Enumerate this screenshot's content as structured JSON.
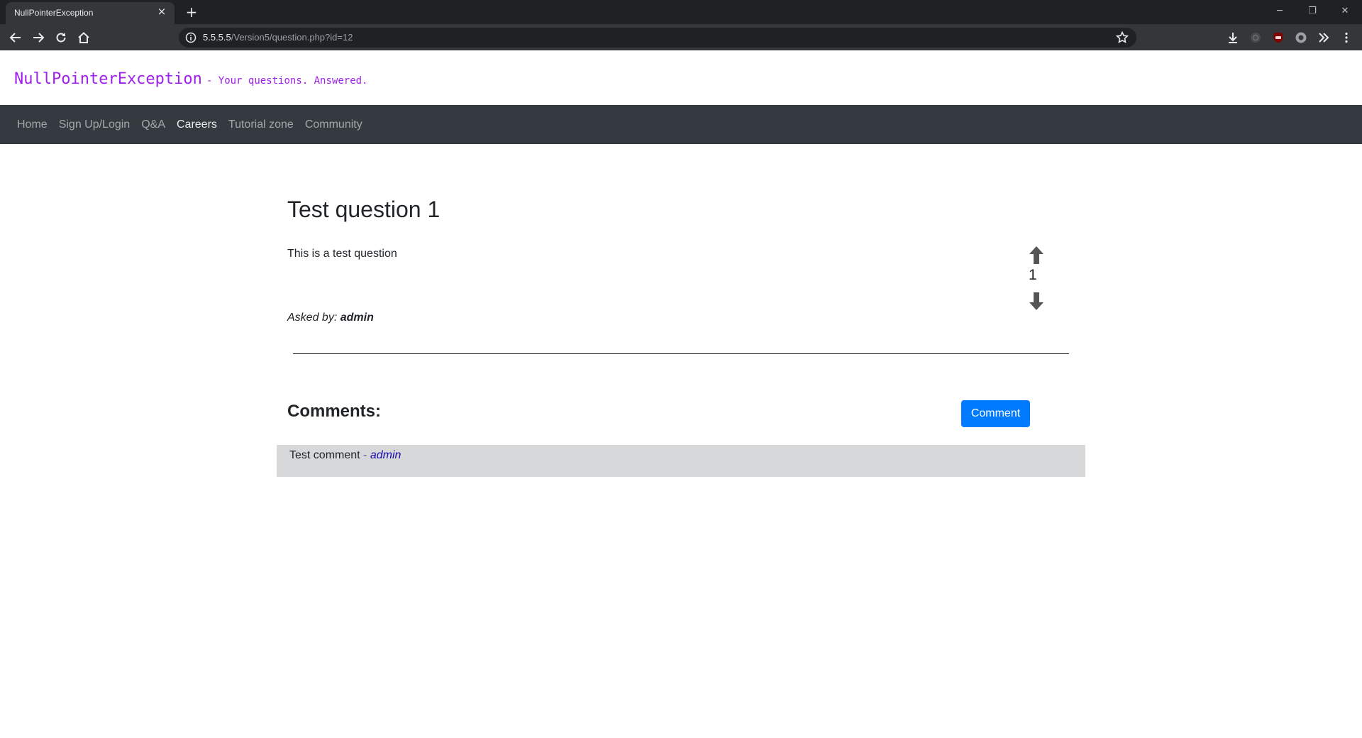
{
  "browser": {
    "tab_title": "NullPointerException",
    "tab_close": "×",
    "new_tab": "+",
    "url_host": "5.5.5.5",
    "url_path": "/Version5/question.php?id=12",
    "window_controls": {
      "minimize": "─",
      "restore": "❐",
      "close": "✕"
    }
  },
  "site": {
    "brand_name": "NullPointerException",
    "tagline": "- Your questions. Answered.",
    "brand_color": "#a020f0",
    "nav": [
      {
        "label": "Home",
        "active": false
      },
      {
        "label": "Sign Up/Login",
        "active": false
      },
      {
        "label": "Q&A",
        "active": false
      },
      {
        "label": "Careers",
        "active": true
      },
      {
        "label": "Tutorial zone",
        "active": false
      },
      {
        "label": "Community",
        "active": false
      }
    ]
  },
  "question": {
    "title": "Test question 1",
    "body": "This is a test question",
    "asked_by_label": "Asked by:",
    "author": "admin",
    "votes": "1"
  },
  "comments": {
    "heading": "Comments:",
    "button_label": "Comment",
    "button_color": "#007bff",
    "items": [
      {
        "text": "Test comment",
        "separator": "-",
        "author": "admin"
      }
    ]
  }
}
